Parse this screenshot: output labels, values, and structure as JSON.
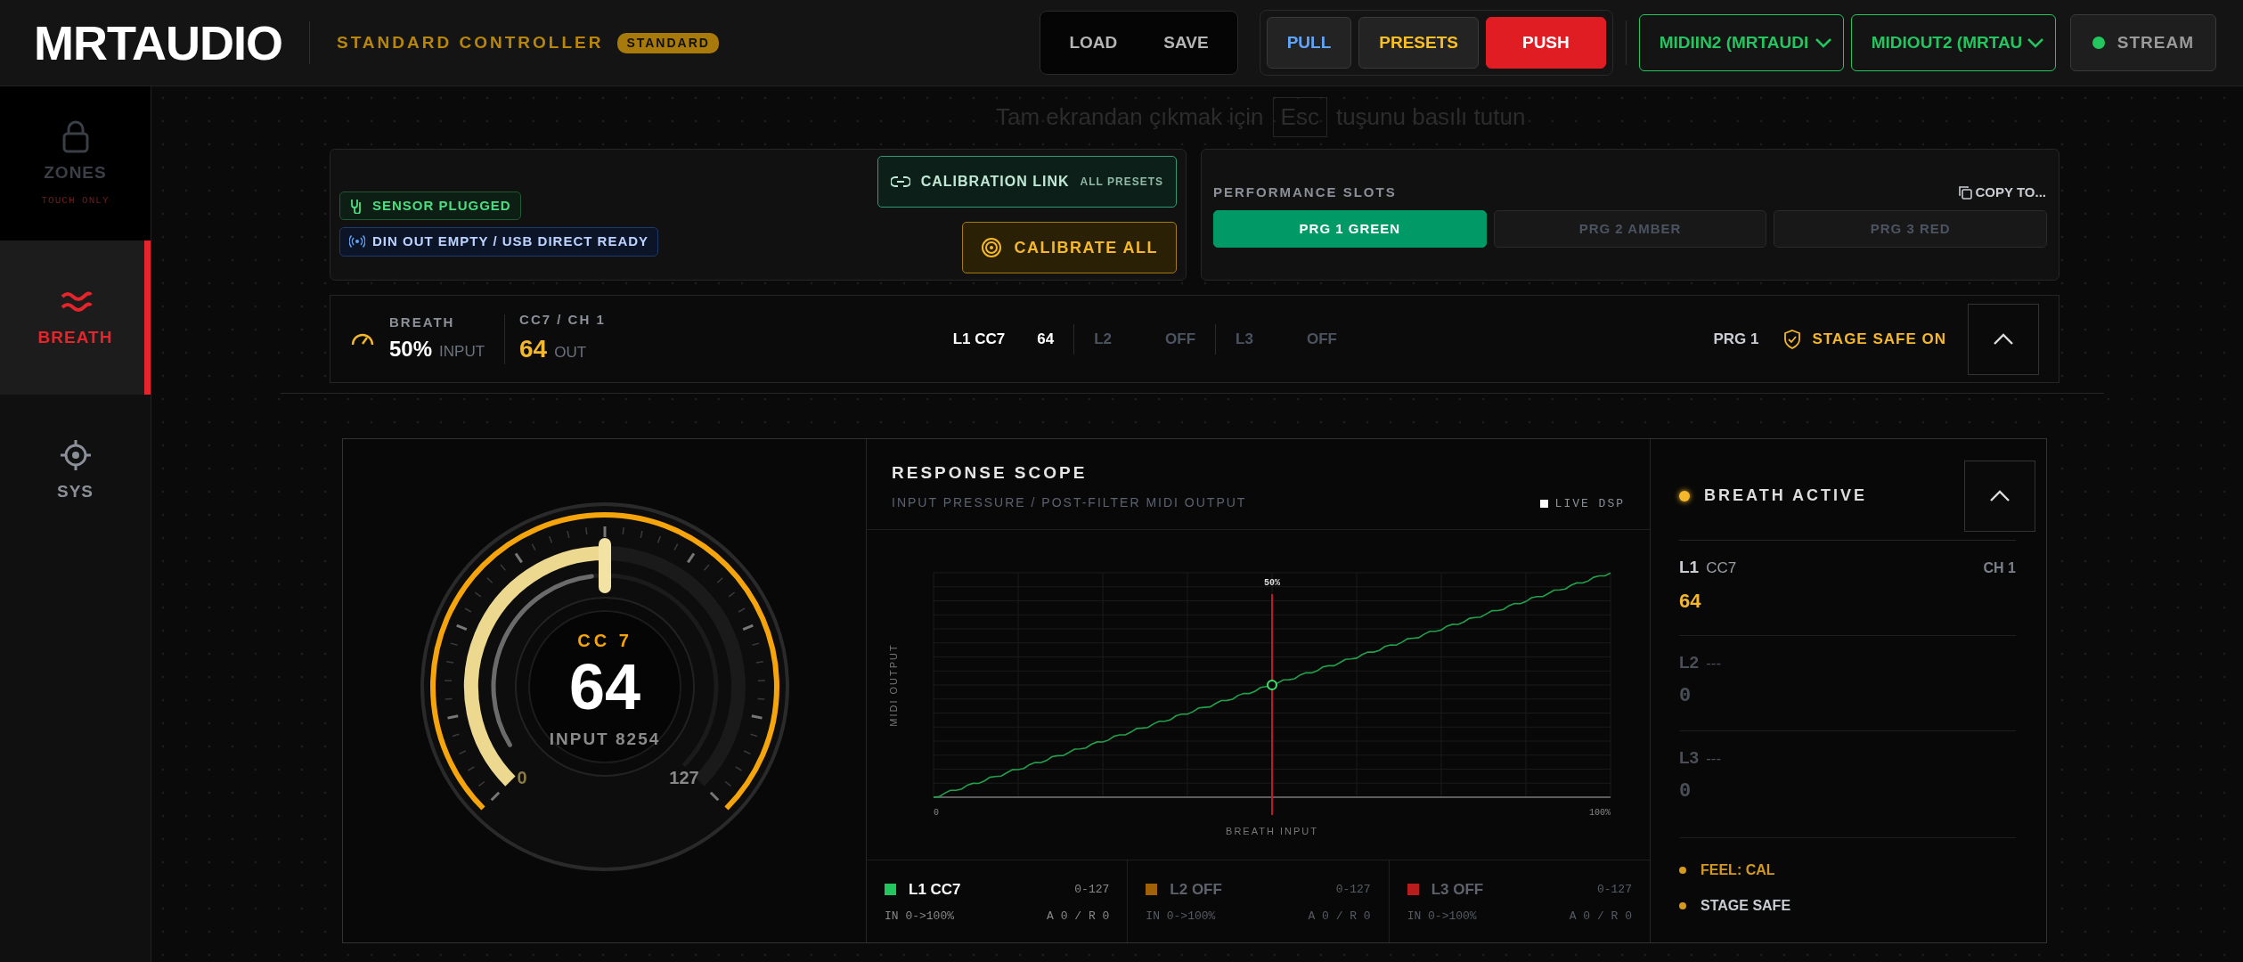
{
  "app": {
    "logo": "MRTAUDIO",
    "subtitle": "STANDARD CONTROLLER",
    "mode_badge": "STANDARD"
  },
  "file_buttons": [
    "LOAD",
    "SAVE"
  ],
  "sync_buttons": [
    {
      "label": "PULL",
      "kind": "pull"
    },
    {
      "label": "PRESETS",
      "kind": "presets"
    },
    {
      "label": "PUSH",
      "kind": "push"
    }
  ],
  "midi_ports": [
    {
      "value": "MIDIIN2 (MRTAUDI"
    },
    {
      "value": "MIDIOUT2 (MRTAU"
    }
  ],
  "stream": {
    "label": "STREAM",
    "on": true
  },
  "sidebar": {
    "items": [
      {
        "label": "ZONES",
        "note": "TOUCH ONLY",
        "selected": false,
        "disabled": true
      },
      {
        "label": "BREATH",
        "selected": true,
        "disabled": false
      },
      {
        "label": "SYS",
        "selected": false,
        "disabled": false
      }
    ]
  },
  "fullscreen_notice": {
    "before": "Tam ekrandan çıkmak için",
    "key": "Esc",
    "after": "tuşunu basılı tutun"
  },
  "status_card": {
    "chips": [
      {
        "label": "SENSOR PLUGGED",
        "kind": "sensor"
      },
      {
        "label": "DIN OUT EMPTY / USB DIRECT READY",
        "kind": "usb"
      }
    ],
    "calibration_link": {
      "label": "CALIBRATION LINK",
      "scope": "ALL PRESETS"
    },
    "calibrate_button": "CALIBRATE ALL"
  },
  "slots": {
    "title": "PERFORMANCE SLOTS",
    "copy": "COPY TO...",
    "items": [
      {
        "label": "PRG 1 GREEN",
        "selected": true
      },
      {
        "label": "PRG 2 AMBER",
        "selected": false
      },
      {
        "label": "PRG 3 RED",
        "selected": false
      }
    ]
  },
  "summary": {
    "source": "BREATH",
    "input": "50%",
    "input_label": "INPUT",
    "target": "CC7 / CH 1",
    "out": "64",
    "out_label": "OUT",
    "layers": [
      {
        "name": "L1 CC7",
        "value": "64",
        "on": true
      },
      {
        "name": "L2",
        "value": "OFF",
        "on": false
      },
      {
        "name": "L3",
        "value": "OFF",
        "on": false
      }
    ],
    "program": "PRG 1",
    "stage_safe": "STAGE SAFE ON"
  },
  "gauge": {
    "cc": "CC 7",
    "value": "64",
    "input_label": "INPUT",
    "input": "8254",
    "level": 0.5,
    "min": "0",
    "max": "127"
  },
  "scope": {
    "title": "RESPONSE SCOPE",
    "subtitle": "INPUT PRESSURE / POST-FILTER MIDI OUTPUT",
    "live": "LIVE DSP",
    "ylabel": "MIDI OUTPUT",
    "xlabel": "BREATH INPUT",
    "x_min": "0",
    "x_max": "100%",
    "cursor": {
      "label": "50%",
      "level": 0.5
    },
    "layers": [
      {
        "name": "L1 CC7",
        "range": "0-127",
        "mapping": "IN 0->100%",
        "ar": "A 0 / R 0",
        "color": "#22c55e",
        "on": true
      },
      {
        "name": "L2 OFF",
        "range": "0-127",
        "mapping": "IN 0->100%",
        "ar": "A 0 / R 0",
        "color": "#a16207",
        "on": false
      },
      {
        "name": "L3 OFF",
        "range": "0-127",
        "mapping": "IN 0->100%",
        "ar": "A 0 / R 0",
        "color": "#b91c1c",
        "on": false
      }
    ]
  },
  "monitor": {
    "status": "BREATH ACTIVE",
    "layers": [
      {
        "name": "L1",
        "target": "CC7",
        "channel": "CH 1",
        "value": "64",
        "on": true
      },
      {
        "name": "L2",
        "target": "---",
        "value": "0",
        "on": false
      },
      {
        "name": "L3",
        "target": "---",
        "value": "0",
        "on": false
      }
    ],
    "flags": [
      {
        "label": "FEEL: CAL",
        "kind": "feel"
      },
      {
        "label": "STAGE SAFE",
        "kind": "safe"
      }
    ]
  }
}
